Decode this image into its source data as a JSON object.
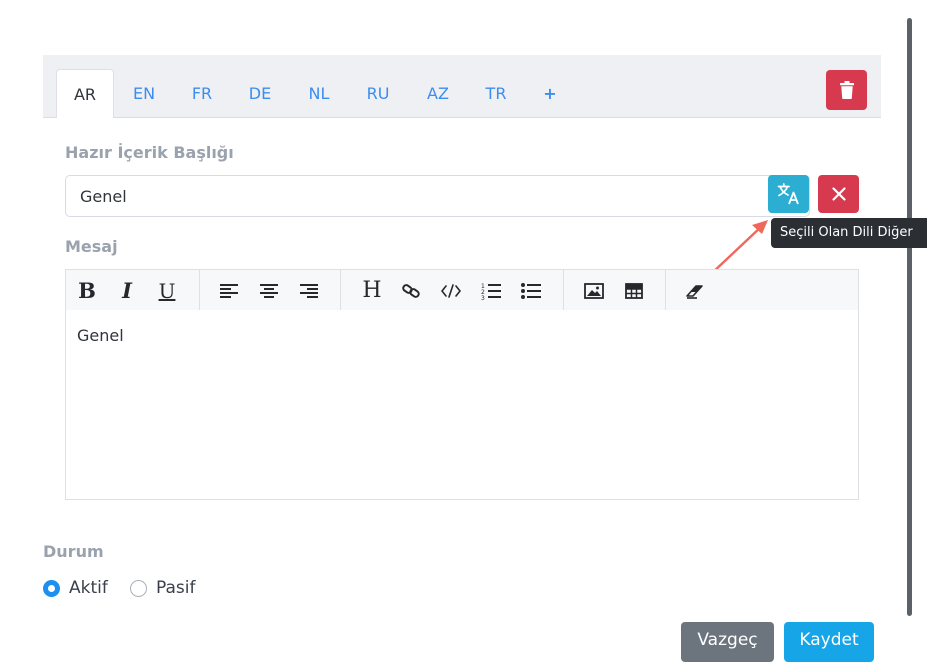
{
  "tabs": [
    {
      "label": "AR",
      "active": true
    },
    {
      "label": "EN",
      "active": false
    },
    {
      "label": "FR",
      "active": false
    },
    {
      "label": "DE",
      "active": false
    },
    {
      "label": "NL",
      "active": false
    },
    {
      "label": "RU",
      "active": false
    },
    {
      "label": "AZ",
      "active": false
    },
    {
      "label": "TR",
      "active": false
    },
    {
      "label": "+",
      "active": false
    }
  ],
  "form": {
    "title_label": "Hazır İçerik Başlığı",
    "title_value": "Genel",
    "message_label": "Mesaj",
    "message_body": "Genel",
    "tooltip": "Seçili Olan Dili Diğer",
    "status_label": "Durum",
    "status_options": [
      {
        "label": "Aktif",
        "checked": true
      },
      {
        "label": "Pasif",
        "checked": false
      }
    ]
  },
  "toolbar_icons": [
    "bold-icon",
    "italic-icon",
    "underline-icon",
    "align-left-icon",
    "align-center-icon",
    "align-right-icon",
    "heading-icon",
    "link-icon",
    "code-icon",
    "ordered-list-icon",
    "unordered-list-icon",
    "image-icon",
    "table-icon",
    "eraser-icon"
  ],
  "buttons": {
    "cancel": "Vazgeç",
    "save": "Kaydet"
  },
  "colors": {
    "tab_link": "#3d8cf0",
    "danger": "#d73a4f",
    "info": "#2baed1",
    "primary": "#1e8ff0",
    "save": "#16a6e8",
    "cancel": "#6c757d",
    "arrow": "#f0675b"
  }
}
